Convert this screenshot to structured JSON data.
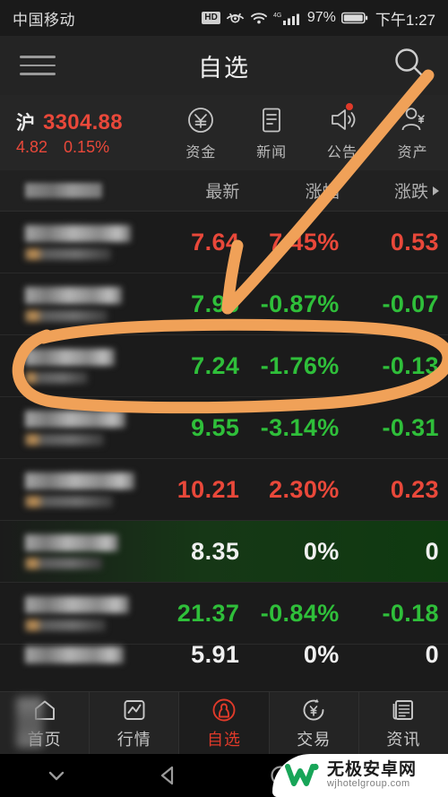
{
  "statusbar": {
    "carrier": "中国移动",
    "hd": "HD",
    "eye_icon": "eye-care-icon",
    "wifi_icon": "wifi-icon",
    "network": "4G",
    "signal_icon": "signal-bars-icon",
    "battery_percent": "97%",
    "battery_icon": "battery-icon",
    "time": "下午1:27"
  },
  "appbar": {
    "menu_icon": "hamburger-menu-icon",
    "title": "自选",
    "search_icon": "search-icon"
  },
  "index": {
    "name": "沪",
    "value": "3304.88",
    "change": "4.82",
    "change_percent": "0.15%",
    "color": "#e9483a"
  },
  "quick_actions": [
    {
      "label": "资金",
      "icon": "yuan-circle-icon",
      "badge": false
    },
    {
      "label": "新闻",
      "icon": "document-lines-icon",
      "badge": false
    },
    {
      "label": "公告",
      "icon": "speaker-announcement-icon",
      "badge": true
    },
    {
      "label": "资产",
      "icon": "person-yuan-icon",
      "badge": false
    }
  ],
  "table": {
    "columns": {
      "name": "",
      "latest": "最新",
      "change_percent": "涨幅",
      "change": "涨跌",
      "sort_icon": "sort-triangle-icon"
    },
    "rows": [
      {
        "name": "",
        "code": "",
        "latest": "7.64",
        "change_percent": "7.45%",
        "change": "0.53",
        "dir": "up",
        "highlight": "none"
      },
      {
        "name": "",
        "code": "",
        "latest": "7.96",
        "change_percent": "-0.87%",
        "change": "-0.07",
        "dir": "down",
        "highlight": "none"
      },
      {
        "name": "",
        "code": "",
        "latest": "7.24",
        "change_percent": "-1.76%",
        "change": "-0.13",
        "dir": "down",
        "highlight": "none"
      },
      {
        "name": "",
        "code": "",
        "latest": "9.55",
        "change_percent": "-3.14%",
        "change": "-0.31",
        "dir": "down",
        "highlight": "none"
      },
      {
        "name": "",
        "code": "",
        "latest": "10.21",
        "change_percent": "2.30%",
        "change": "0.23",
        "dir": "up",
        "highlight": "none"
      },
      {
        "name": "",
        "code": "",
        "latest": "8.35",
        "change_percent": "0%",
        "change": "0",
        "dir": "flat",
        "highlight": "green"
      },
      {
        "name": "",
        "code": "",
        "latest": "21.37",
        "change_percent": "-0.84%",
        "change": "-0.18",
        "dir": "down",
        "highlight": "none"
      },
      {
        "name": "",
        "code": "",
        "latest": "5.91",
        "change_percent": "0%",
        "change": "0",
        "dir": "flat",
        "highlight": "none"
      }
    ]
  },
  "bottom_nav": {
    "active": "自选",
    "items": [
      {
        "label": "首页",
        "icon": "home-icon",
        "active": false
      },
      {
        "label": "行情",
        "icon": "chart-line-icon",
        "active": false
      },
      {
        "label": "自选",
        "icon": "person-circle-icon",
        "active": true
      },
      {
        "label": "交易",
        "icon": "yuan-refresh-icon",
        "active": false
      },
      {
        "label": "资讯",
        "icon": "newspaper-icon",
        "active": false
      }
    ],
    "active_color": "#e03a2a"
  },
  "android_nav": {
    "items": [
      {
        "icon": "chevron-down-icon"
      },
      {
        "icon": "back-triangle-icon"
      },
      {
        "icon": "home-circle-icon"
      }
    ]
  },
  "watermark": {
    "logo_icon": "w-logo-icon",
    "title": "无极安卓网",
    "url": "wjhotelgroup.com",
    "logo_color": "#18a558"
  },
  "annotations": {
    "color": "#f0a158",
    "arrow": "hand-drawn-arrow-pointing-to-row-3",
    "ellipse": "hand-drawn-ellipse-around-row-3"
  }
}
